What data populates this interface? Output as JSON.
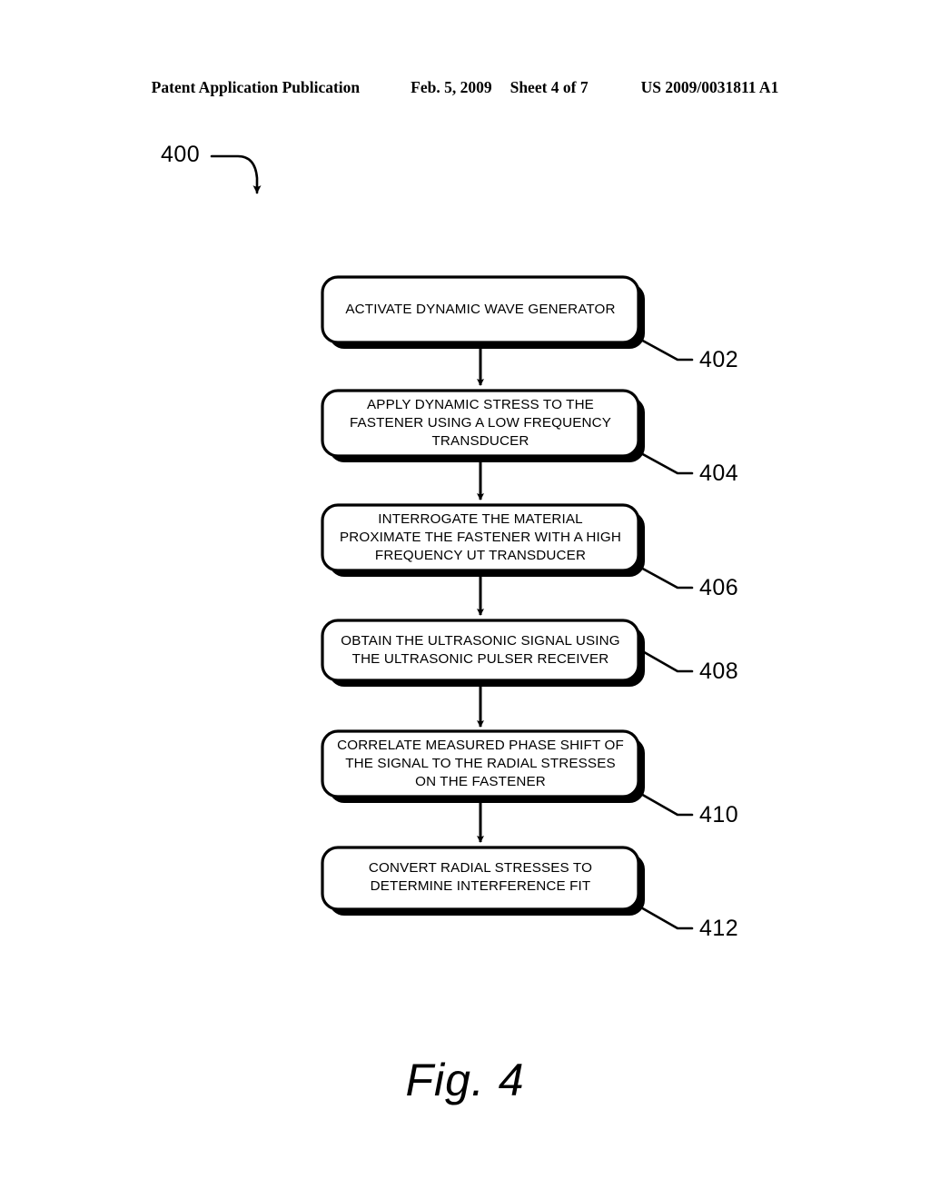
{
  "header": {
    "publication": "Patent Application Publication",
    "date": "Feb. 5, 2009",
    "sheet": "Sheet 4 of 7",
    "publication_number": "US 2009/0031811 A1"
  },
  "figure": {
    "caption": "Fig. 4",
    "diagram_ref": "400",
    "colors": {
      "stroke": "#000000",
      "fill": "#ffffff",
      "shadow": "#000000"
    }
  },
  "flowchart": {
    "steps": [
      {
        "ref": "402",
        "text": "ACTIVATE DYNAMIC WAVE GENERATOR"
      },
      {
        "ref": "404",
        "text": "APPLY DYNAMIC STRESS TO THE\nFASTENER USING A LOW FREQUENCY\nTRANSDUCER"
      },
      {
        "ref": "406",
        "text": "INTERROGATE THE MATERIAL\nPROXIMATE THE FASTENER WITH A HIGH\nFREQUENCY UT TRANSDUCER"
      },
      {
        "ref": "408",
        "text": "OBTAIN THE ULTRASONIC SIGNAL USING\nTHE ULTRASONIC PULSER RECEIVER"
      },
      {
        "ref": "410",
        "text": "CORRELATE MEASURED PHASE SHIFT OF\nTHE SIGNAL TO THE RADIAL STRESSES\nON THE FASTENER"
      },
      {
        "ref": "412",
        "text": "CONVERT RADIAL STRESSES TO\nDETERMINE INTERFERENCE FIT"
      }
    ]
  }
}
